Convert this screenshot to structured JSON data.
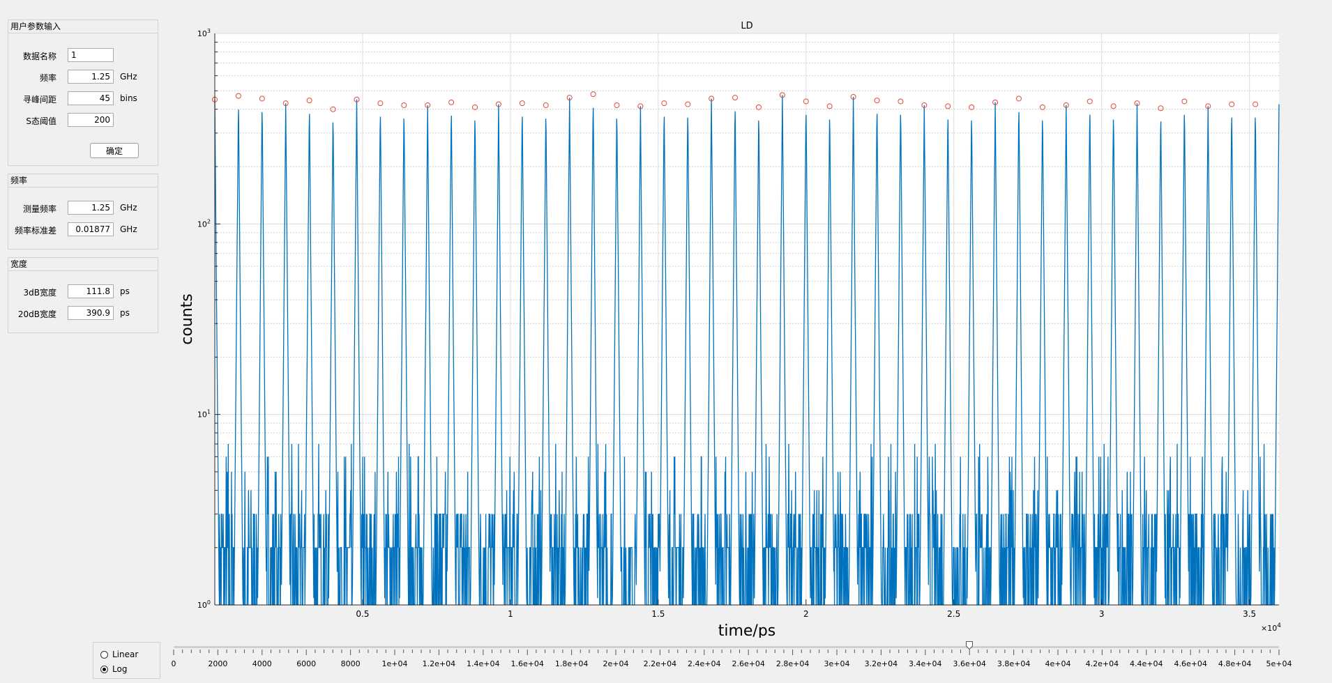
{
  "params_panel": {
    "title": "用户参数输入",
    "fields": [
      {
        "label": "数据名称",
        "value": "1",
        "unit": ""
      },
      {
        "label": "频率",
        "value": "1.25",
        "unit": "GHz"
      },
      {
        "label": "寻峰间距",
        "value": "45",
        "unit": "bins"
      },
      {
        "label": "S态阈值",
        "value": "200",
        "unit": ""
      }
    ],
    "confirm_label": "确定"
  },
  "freq_panel": {
    "title": "频率",
    "fields": [
      {
        "label": "测量频率",
        "value": "1.25",
        "unit": "GHz"
      },
      {
        "label": "频率标准差",
        "value": "0.01877",
        "unit": "GHz"
      }
    ]
  },
  "width_panel": {
    "title": "宽度",
    "fields": [
      {
        "label": "3dB宽度",
        "value": "111.8",
        "unit": "ps"
      },
      {
        "label": "20dB宽度",
        "value": "390.9",
        "unit": "ps"
      }
    ]
  },
  "scale_toggle": {
    "options": [
      "Linear",
      "Log"
    ],
    "selected": "Log"
  },
  "slider": {
    "min": 0,
    "max": 50000,
    "value": 36000,
    "tick_labels": [
      "0",
      "2000",
      "4000",
      "6000",
      "8000",
      "1e+04",
      "1.2e+04",
      "1.4e+04",
      "1.6e+04",
      "1.8e+04",
      "2e+04",
      "2.2e+04",
      "2.4e+04",
      "2.6e+04",
      "2.8e+04",
      "3e+04",
      "3.2e+04",
      "3.4e+04",
      "3.6e+04",
      "3.8e+04",
      "4e+04",
      "4.2e+04",
      "4.4e+04",
      "4.6e+04",
      "4.8e+04",
      "5e+04"
    ]
  },
  "colors": {
    "line": "#0072bd",
    "peak_marker": "#e0483a",
    "grid": "#cfcfcf"
  },
  "chart_data": {
    "type": "line",
    "title": "LD",
    "xlabel": "time/ps",
    "ylabel": "counts",
    "yscale": "log",
    "xlim": [
      0,
      36000
    ],
    "ylim": [
      1,
      1000
    ],
    "x_tick_values": [
      5000,
      10000,
      15000,
      20000,
      25000,
      30000,
      35000
    ],
    "x_tick_labels": [
      "0.5",
      "1",
      "1.5",
      "2",
      "2.5",
      "3",
      "3.5"
    ],
    "x_exponent_label": "×10",
    "x_exponent_power": "4",
    "y_tick_values": [
      1,
      10,
      100,
      1000
    ],
    "y_tick_bases": [
      "10",
      "10",
      "10",
      "10"
    ],
    "y_tick_powers": [
      "0",
      "1",
      "2",
      "3"
    ],
    "grid": true,
    "series": [
      {
        "pulse_period_ps": 800,
        "pulse_width_ps": 300,
        "peaks_x": [
          0,
          800,
          1600,
          2400,
          3200,
          4000,
          4800,
          5600,
          6400,
          7200,
          8000,
          8800,
          9600,
          10400,
          11200,
          12000,
          12800,
          13600,
          14400,
          15200,
          16000,
          16800,
          17600,
          18400,
          19200,
          20000,
          20800,
          21600,
          22400,
          23200,
          24000,
          24800,
          25600,
          26400,
          27200,
          28000,
          28800,
          29600,
          30400,
          31200,
          32000,
          32800,
          33600,
          34400,
          35200
        ],
        "peaks_y": [
          450,
          470,
          455,
          430,
          445,
          400,
          450,
          430,
          420,
          420,
          435,
          410,
          425,
          430,
          420,
          460,
          480,
          420,
          415,
          430,
          425,
          455,
          460,
          410,
          475,
          440,
          415,
          465,
          445,
          440,
          420,
          415,
          410,
          435,
          455,
          410,
          420,
          440,
          415,
          430,
          405,
          440,
          415,
          425,
          425
        ]
      }
    ]
  }
}
